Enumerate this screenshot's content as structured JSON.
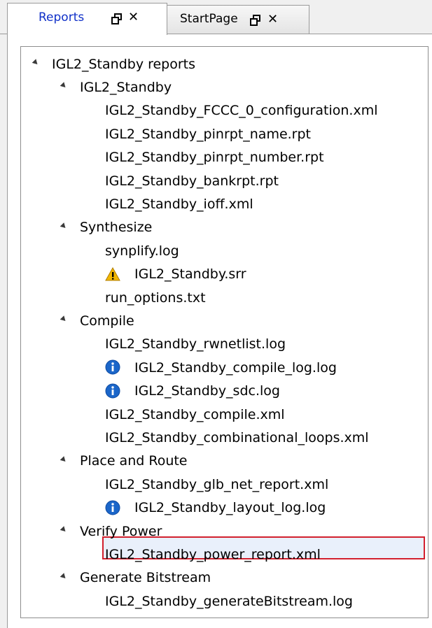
{
  "tabs": [
    {
      "label": "Reports",
      "active": true,
      "pin_icon": "pin-icon",
      "close_icon": "close-icon",
      "close_glyph": "✕"
    },
    {
      "label": "StartPage",
      "active": false,
      "pin_icon": "pin-icon",
      "close_icon": "close-icon",
      "close_glyph": "✕"
    }
  ],
  "tree": {
    "root": "IGL2_Standby reports",
    "groups": [
      {
        "label": "IGL2_Standby",
        "items": [
          {
            "label": "IGL2_Standby_FCCC_0_configuration.xml",
            "icon": null
          },
          {
            "label": "IGL2_Standby_pinrpt_name.rpt",
            "icon": null
          },
          {
            "label": "IGL2_Standby_pinrpt_number.rpt",
            "icon": null
          },
          {
            "label": "IGL2_Standby_bankrpt.rpt",
            "icon": null
          },
          {
            "label": "IGL2_Standby_ioff.xml",
            "icon": null
          }
        ]
      },
      {
        "label": "Synthesize",
        "items": [
          {
            "label": "synplify.log",
            "icon": null
          },
          {
            "label": "IGL2_Standby.srr",
            "icon": "warning-icon"
          },
          {
            "label": "run_options.txt",
            "icon": null
          }
        ]
      },
      {
        "label": "Compile",
        "items": [
          {
            "label": "IGL2_Standby_rwnetlist.log",
            "icon": null
          },
          {
            "label": "IGL2_Standby_compile_log.log",
            "icon": "info-icon"
          },
          {
            "label": "IGL2_Standby_sdc.log",
            "icon": "info-icon"
          },
          {
            "label": "IGL2_Standby_compile.xml",
            "icon": null
          },
          {
            "label": "IGL2_Standby_combinational_loops.xml",
            "icon": null
          }
        ]
      },
      {
        "label": "Place and Route",
        "items": [
          {
            "label": "IGL2_Standby_glb_net_report.xml",
            "icon": null
          },
          {
            "label": "IGL2_Standby_layout_log.log",
            "icon": "info-icon"
          }
        ]
      },
      {
        "label": "Verify Power",
        "items": [
          {
            "label": "IGL2_Standby_power_report.xml",
            "icon": null,
            "selected": true
          }
        ]
      },
      {
        "label": "Generate Bitstream",
        "items": [
          {
            "label": "IGL2_Standby_generateBitstream.log",
            "icon": null
          }
        ]
      }
    ]
  },
  "colors": {
    "active_tab_text": "#1030c8",
    "selection_border": "#d2202e",
    "info_icon": "#1b66c9",
    "warning_icon": "#f2b700"
  }
}
